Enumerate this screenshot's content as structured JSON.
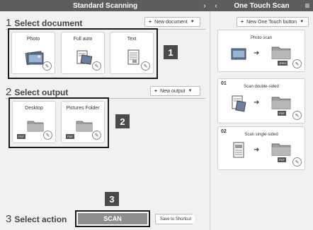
{
  "left_panel": {
    "title": "Standard Scanning",
    "collapse_icon": "chevron-right-icon",
    "select_document": {
      "number": "1",
      "title": "Select document",
      "new_button": "New document",
      "badge": "1",
      "cards": [
        {
          "label": "Photo"
        },
        {
          "label": "Full auto"
        },
        {
          "label": "Text"
        }
      ]
    },
    "select_output": {
      "number": "2",
      "title": "Select output",
      "new_button": "New output",
      "badge": "2",
      "cards": [
        {
          "label": "Desktop",
          "format": "PDF"
        },
        {
          "label": "Pictures Folder",
          "format": "PDF"
        }
      ]
    },
    "select_action": {
      "number": "3",
      "title": "Select action",
      "badge": "3",
      "scan_label": "SCAN",
      "shortcut_label": "Save to Shortcut"
    }
  },
  "right_panel": {
    "title": "One Touch Scan",
    "back_icon": "chevron-left-icon",
    "menu_icon": "menu-icon",
    "new_button": "New One Touch button",
    "items": [
      {
        "number": "",
        "label": "Photo scan",
        "format": "JPEG"
      },
      {
        "number": "01",
        "label": "Scan double-sided",
        "format": "PDF"
      },
      {
        "number": "02",
        "label": "Scan single-sided",
        "format": "PDF"
      }
    ]
  },
  "colors": {
    "header_bg": "#5d5d5d",
    "panel_bg": "#f1f1f1",
    "scan_button": "#8e8e8e",
    "highlight_border": "#1a1a1a"
  }
}
